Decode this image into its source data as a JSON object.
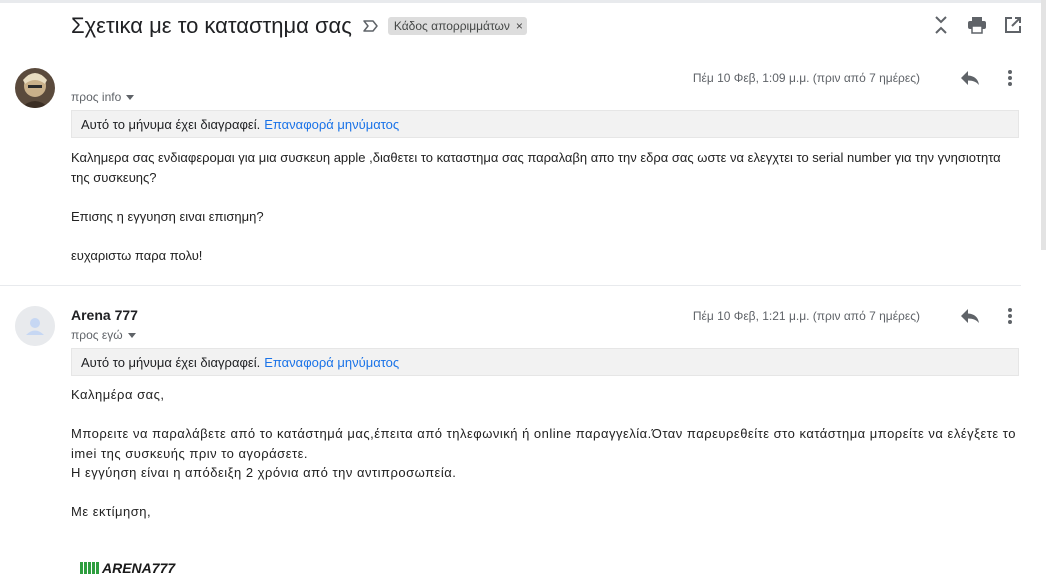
{
  "thread": {
    "subject": "Σχετικα με το καταστημα σας",
    "label_chip": "Κάδος απορριμμάτων",
    "label_chip_close": "×",
    "icons": {
      "importance": "label-arrow-icon",
      "collapse": "collapse-all-icon",
      "print": "print-icon",
      "new_window": "open-in-new-window-icon"
    }
  },
  "messages": [
    {
      "sender": "",
      "to": "προς info",
      "date": "Πέμ 10 Φεβ, 1:09 μ.μ. (πριν από 7 ημέρες)",
      "deleted_notice": "Αυτό το μήνυμα έχει διαγραφεί.",
      "restore_link": "Επαναφορά μηνύματος",
      "body": [
        "Καλημερα σας ενδιαφερομαι για μια συσκευη apple ,διαθετει το καταστημα σας παραλαβη απο την εδρα σας ωστε να ελεγχτει το serial number για την γνησιοτητα της συσκευης?",
        "",
        "Επισης η εγγυηση ειναι επισημη?",
        "",
        "ευχαριστω παρα πολυ!"
      ]
    },
    {
      "sender": "Arena 777",
      "to": "προς εγώ",
      "date": "Πέμ 10 Φεβ, 1:21 μ.μ. (πριν από 7 ημέρες)",
      "deleted_notice": "Αυτό το μήνυμα έχει διαγραφεί.",
      "restore_link": "Επαναφορά μηνύματος",
      "body": [
        "Καλημέρα σας,",
        "",
        "Μπορειτε να παραλάβετε από το κατάστημά μας,έπειτα από τηλεφωνική ή online παραγγελία.Όταν παρευρεθείτε στο κατάστημα μπορείτε να ελέγξετε το imei της συσκευής πριν το αγοράσετε.",
        "Η εγγύηση είναι η απόδειξη 2 χρόνια από την αντιπροσωπεία.",
        "",
        "Με εκτίμηση,"
      ],
      "signature_logo_text": "ARENA777"
    }
  ],
  "colors": {
    "link": "#1a73e8",
    "chip_bg": "#dddddd",
    "deleted_bar_bg": "#f2f2f2",
    "secondary_text": "#5f6368"
  }
}
